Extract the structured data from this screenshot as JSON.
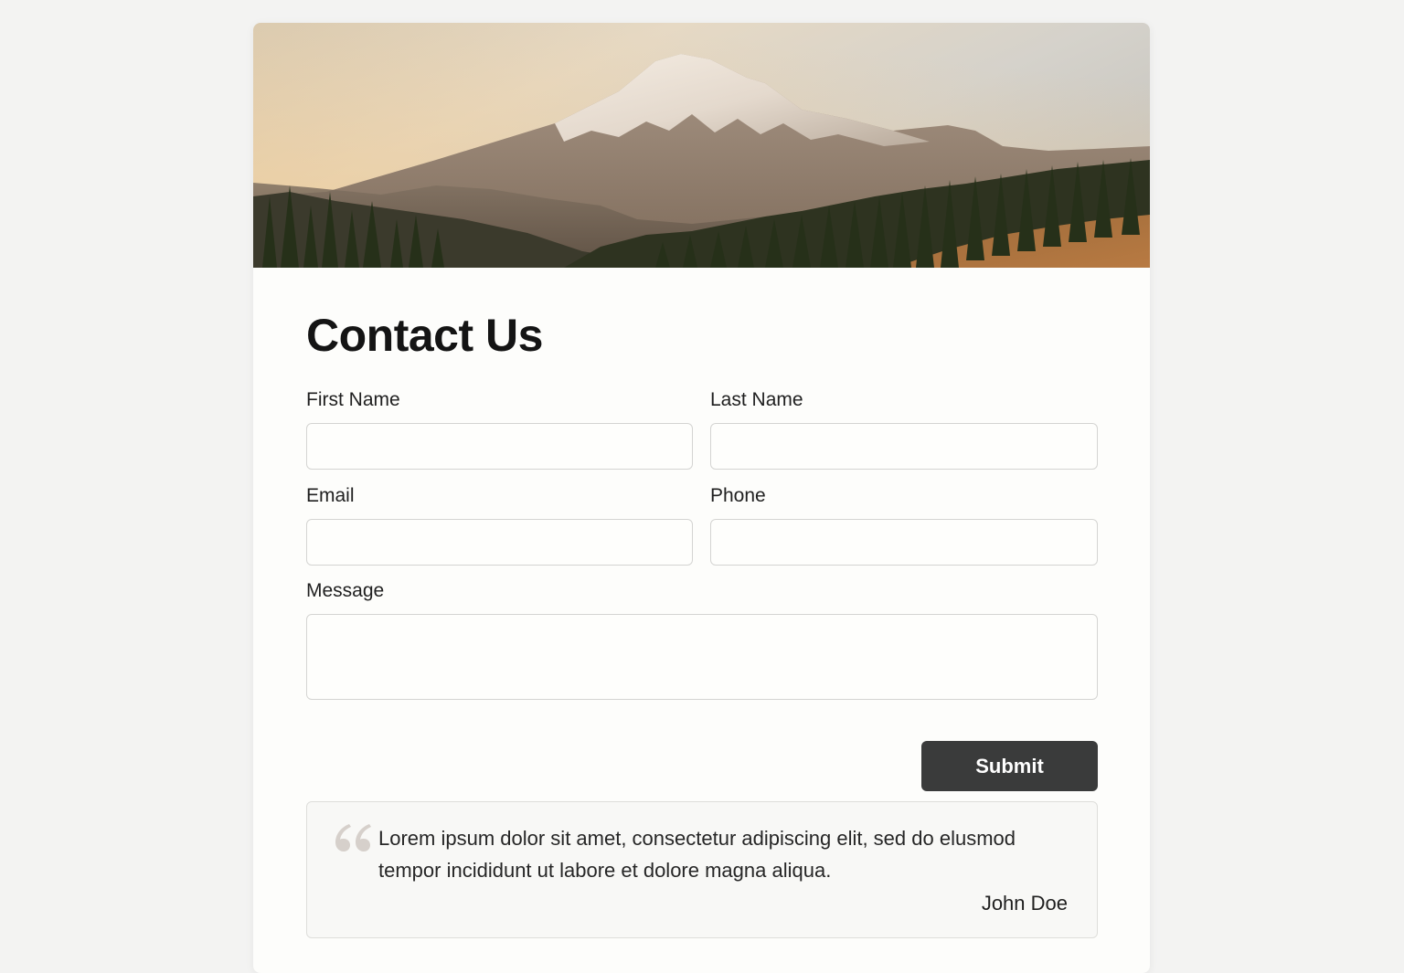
{
  "hero": {
    "image": "mountain-landscape"
  },
  "form": {
    "title": "Contact Us",
    "first_name_label": "First Name",
    "last_name_label": "Last Name",
    "email_label": "Email",
    "phone_label": "Phone",
    "message_label": "Message",
    "first_name_value": "",
    "last_name_value": "",
    "email_value": "",
    "phone_value": "",
    "message_value": "",
    "submit_label": "Submit"
  },
  "testimonial": {
    "icon": "quote-icon",
    "text": "Lorem ipsum dolor sit amet, consectetur adipiscing elit, sed do elusmod tempor incididunt ut labore et dolore magna aliqua.",
    "author": "John Doe"
  },
  "colors": {
    "page_background": "#f3f3f2",
    "card_background": "#fdfdfb",
    "button_background": "#3a3b3b",
    "button_text": "#ffffff",
    "input_border": "#d4d4d2"
  }
}
